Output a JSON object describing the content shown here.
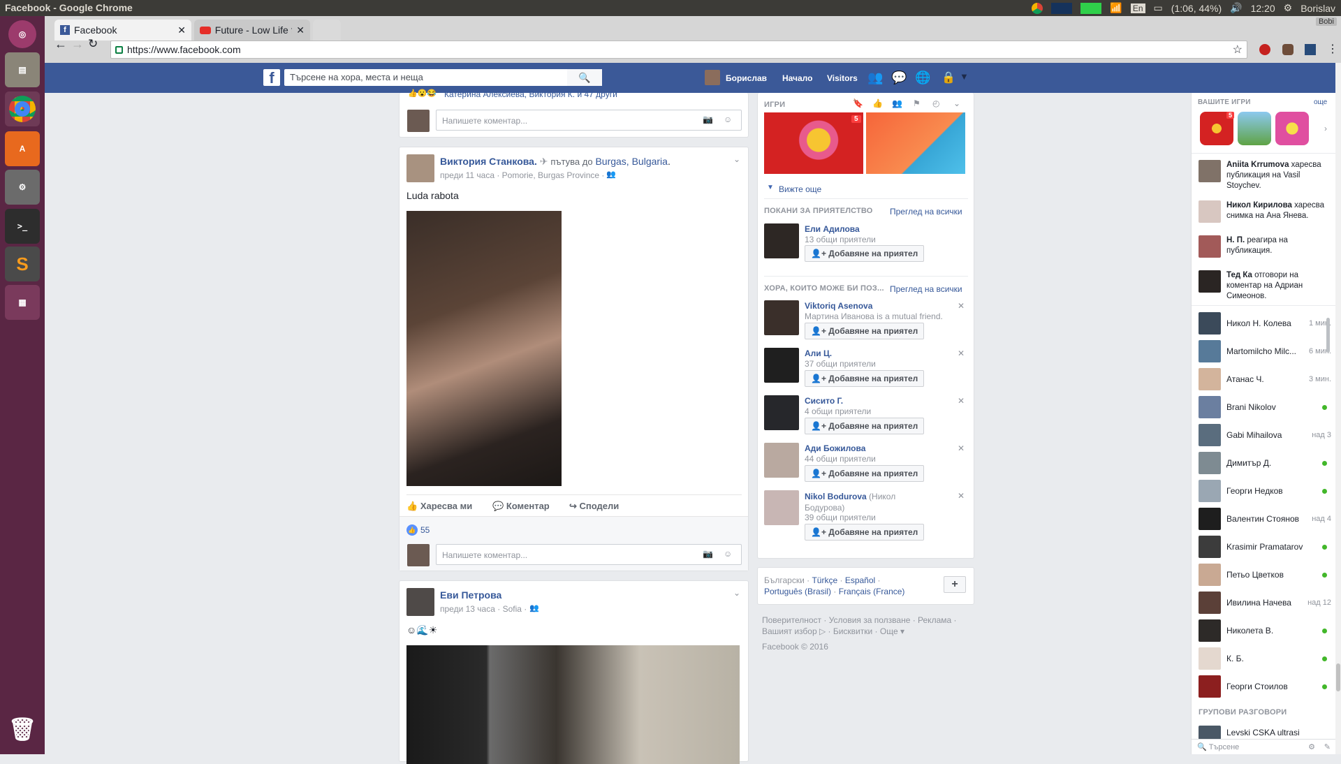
{
  "system": {
    "window_title": "Facebook - Google Chrome",
    "lang": "En",
    "battery": "(1:06, 44%)",
    "time": "12:20",
    "user": "Borislav"
  },
  "browser": {
    "tabs": [
      {
        "label": "Facebook"
      },
      {
        "label": "Future - Low Life ft"
      }
    ],
    "url": "https://www.facebook.com",
    "profile": "Bobi"
  },
  "fb": {
    "search_placeholder": "Търсене на хора, места и неща",
    "nav": {
      "user": "Борислав",
      "home": "Начало",
      "visitors": "Visitors"
    },
    "feed": {
      "top_reactions": "Катерина Алексиева, Виктория К. и 47 други",
      "comment_placeholder": "Напишете коментар...",
      "post1": {
        "author": "Виктория Станкова.",
        "travel": "пътува до",
        "place": "Burgas, Bulgaria",
        "meta": "преди 11 часа · Pomorie, Burgas Province ·",
        "text": "Luda rabota",
        "like": "Харесва ми",
        "comment": "Коментар",
        "share": "Сподели",
        "likes": "55"
      },
      "post2": {
        "author": "Еви Петрова",
        "meta": "преди 13 часа · Sofia ·",
        "text": "☺🌊☀"
      }
    },
    "right": {
      "games_title": "ИГРИ",
      "games_badge": "5",
      "see_more": "Вижте още",
      "friend_req_title": "ПОКАНИ ЗА ПРИЯТЕЛСТВО",
      "see_all": "Преглед на всички",
      "friend_req": {
        "name": "Ели Адилова",
        "meta": "13 общи приятели",
        "btn": "Добавяне на приятел"
      },
      "pymk_title": "ХОРА, КОИТО МОЖЕ БИ ПОЗ...",
      "pymk": [
        {
          "name": "Viktoriq Asenova",
          "meta": "Мартина Иванова is a mutual friend.",
          "btn": "Добавяне на приятел"
        },
        {
          "name": "Али Ц.",
          "meta": "37 общи приятели",
          "btn": "Добавяне на приятел"
        },
        {
          "name": "Сисито Г.",
          "meta": "4 общи приятели",
          "btn": "Добавяне на приятел"
        },
        {
          "name": "Ади Божилова",
          "meta": "44 общи приятели",
          "btn": "Добавяне на приятел"
        },
        {
          "name": "Nikol Bodurova",
          "alt": "(Никол",
          "alt2": "Бодурова)",
          "meta": "39 общи приятели",
          "btn": "Добавяне на приятел"
        }
      ],
      "langs": {
        "l1": "Български ·",
        "l2": "Türkçe",
        "l3": "Español",
        "l4": "Português (Brasil)",
        "l5": "Français (France)",
        "plus": "+"
      },
      "footer": {
        "f1": "Поверителност · Условия за ползване · Реклама ·",
        "f2": "Вашият избор ▷ · Бисквитки · Още ▾",
        "f3": "Facebook © 2016"
      }
    },
    "chat": {
      "games_title": "ВАШИТЕ ИГРИ",
      "more": "още",
      "games_badge": "5",
      "ticker": [
        {
          "who": "Aniita Krrumova",
          "what": "харесва публикация на Vasil Stoychev."
        },
        {
          "who": "Никол Кирилова",
          "what": "харесва снимка на Ана Янева."
        },
        {
          "who": "Н. П.",
          "what": "реагира на публикация."
        },
        {
          "who": "Тед Ка",
          "what": "отговори на коментар на Адриан Симеонов."
        }
      ],
      "contacts": [
        {
          "name": "Никол Н. Колева",
          "status": "1 мин."
        },
        {
          "name": "Martomilcho Milc...",
          "status": "6 мин."
        },
        {
          "name": "Атанас Ч.",
          "status": "3 мин."
        },
        {
          "name": "Brani Nikolov",
          "status": ""
        },
        {
          "name": "Gabi Mihailova",
          "status": "над 3"
        },
        {
          "name": "Димитър Д.",
          "status": ""
        },
        {
          "name": "Георги Недков",
          "status": ""
        },
        {
          "name": "Валентин Стоянов",
          "status": "над 4"
        },
        {
          "name": "Krasimir Pramatarov",
          "status": ""
        },
        {
          "name": "Петьо Цветков",
          "status": ""
        },
        {
          "name": "Ивилина Начева",
          "status": "над 12"
        },
        {
          "name": "Николета В.",
          "status": ""
        },
        {
          "name": "К. Б.",
          "status": ""
        },
        {
          "name": "Георги Стоилов",
          "status": ""
        }
      ],
      "groups_title": "ГРУПОВИ РАЗГОВОРИ",
      "group1": "Levski CSKA ultrasi",
      "search_placeholder": "Търсене"
    }
  },
  "colors": {
    "fb_blue": "#3b5998",
    "online": "#42b72a"
  }
}
